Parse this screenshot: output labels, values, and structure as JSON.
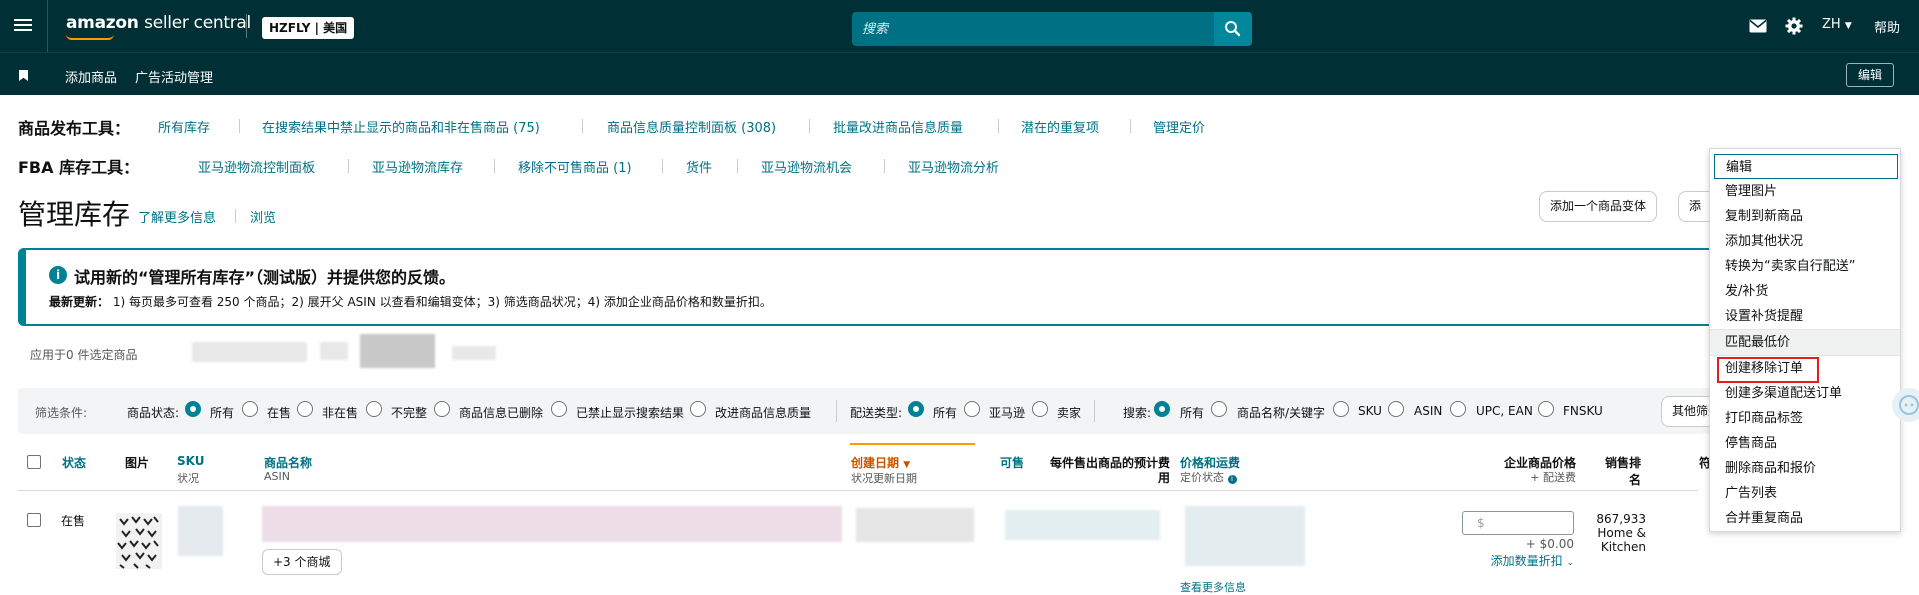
{
  "topbar": {
    "logo_main": "amazon",
    "logo_sub": "seller central",
    "store": "HZFLY | 美国",
    "search_placeholder": "搜索",
    "lang": "ZH",
    "help": "帮助"
  },
  "subnav": {
    "items": [
      "添加商品",
      "广告活动管理"
    ],
    "edit": "编辑"
  },
  "publish_tools": {
    "label": "商品发布工具：",
    "links": [
      "所有库存",
      "在搜索结果中禁止显示的商品和非在售商品 (75)",
      "商品信息质量控制面板 (308)",
      "批量改进商品信息质量",
      "潜在的重复项",
      "管理定价"
    ]
  },
  "fba_tools": {
    "label": "FBA 库存工具：",
    "links": [
      "亚马逊物流控制面板",
      "亚马逊物流库存",
      "移除不可售商品 (1)",
      "货件",
      "亚马逊物流机会",
      "亚马逊物流分析"
    ]
  },
  "page": {
    "title": "管理库存",
    "learn_more": "了解更多信息",
    "browse": "浏览",
    "add_variant": "添加一个商品变体",
    "add_partial": "添加"
  },
  "banner": {
    "title": "试用新的“管理所有库存”（测试版）并提供您的反馈。",
    "latest_label": "最新更新：",
    "text": "1) 每页最多可查看 250 个商品；2) 展开父 ASIN 以查看和编辑变体；3) 筛选商品状况；4) 添加企业商品价格和数量折扣。"
  },
  "apply_label": "应用于0 件选定商品",
  "filters": {
    "conditions_label": "筛选条件:",
    "status_label": "商品状态:",
    "status_options": [
      "所有",
      "在售",
      "非在售",
      "不完整",
      "商品信息已删除",
      "已禁止显示搜索结果",
      "改进商品信息质量"
    ],
    "fulfill_label": "配送类型:",
    "fulfill_options": [
      "所有",
      "亚马逊",
      "卖家"
    ],
    "search_label": "搜索:",
    "search_options": [
      "所有",
      "商品名称/关键字",
      "SKU",
      "ASIN",
      "UPC, EAN",
      "FNSKU"
    ],
    "other_filters": "其他筛选"
  },
  "table": {
    "headers": {
      "status": "状态",
      "image": "图片",
      "sku": "SKU",
      "sku_sub": "状况",
      "name": "商品名称",
      "name_sub": "ASIN",
      "created": "创建日期",
      "created_sub": "状况更新日期",
      "available": "可售",
      "fee_line1": "每件售出商品的预计费",
      "fee_line2": "用",
      "price": "价格和运费",
      "price_sub": "定价状态",
      "biz_price": "企业商品价格",
      "biz_sub": "+ 配送费",
      "rank": "销售排名",
      "partial": "符"
    },
    "row": {
      "status": "在售",
      "more_stores": "+3 个商城",
      "price_placeholder": "$",
      "ship_fee": "+ $0.00",
      "qty_discount": "添加数量折扣",
      "rank_value": "867,933",
      "rank_category": "Home & Kitchen",
      "more_info": "查看更多信息"
    }
  },
  "dropdown": {
    "items": [
      "编辑",
      "管理图片",
      "复制到新商品",
      "添加其他状况",
      "转换为“卖家自行配送”",
      "发/补货",
      "设置补货提醒",
      "匹配最低价",
      "创建移除订单",
      "创建多渠道配送订单",
      "打印商品标签",
      "停售商品",
      "删除商品和报价",
      "广告列表",
      "合并重复商品"
    ]
  },
  "colors": {
    "header_bg": "#002f36",
    "accent": "#008296",
    "link": "#007185",
    "sort_orange": "#ff9900",
    "highlight_red": "#e02020"
  }
}
